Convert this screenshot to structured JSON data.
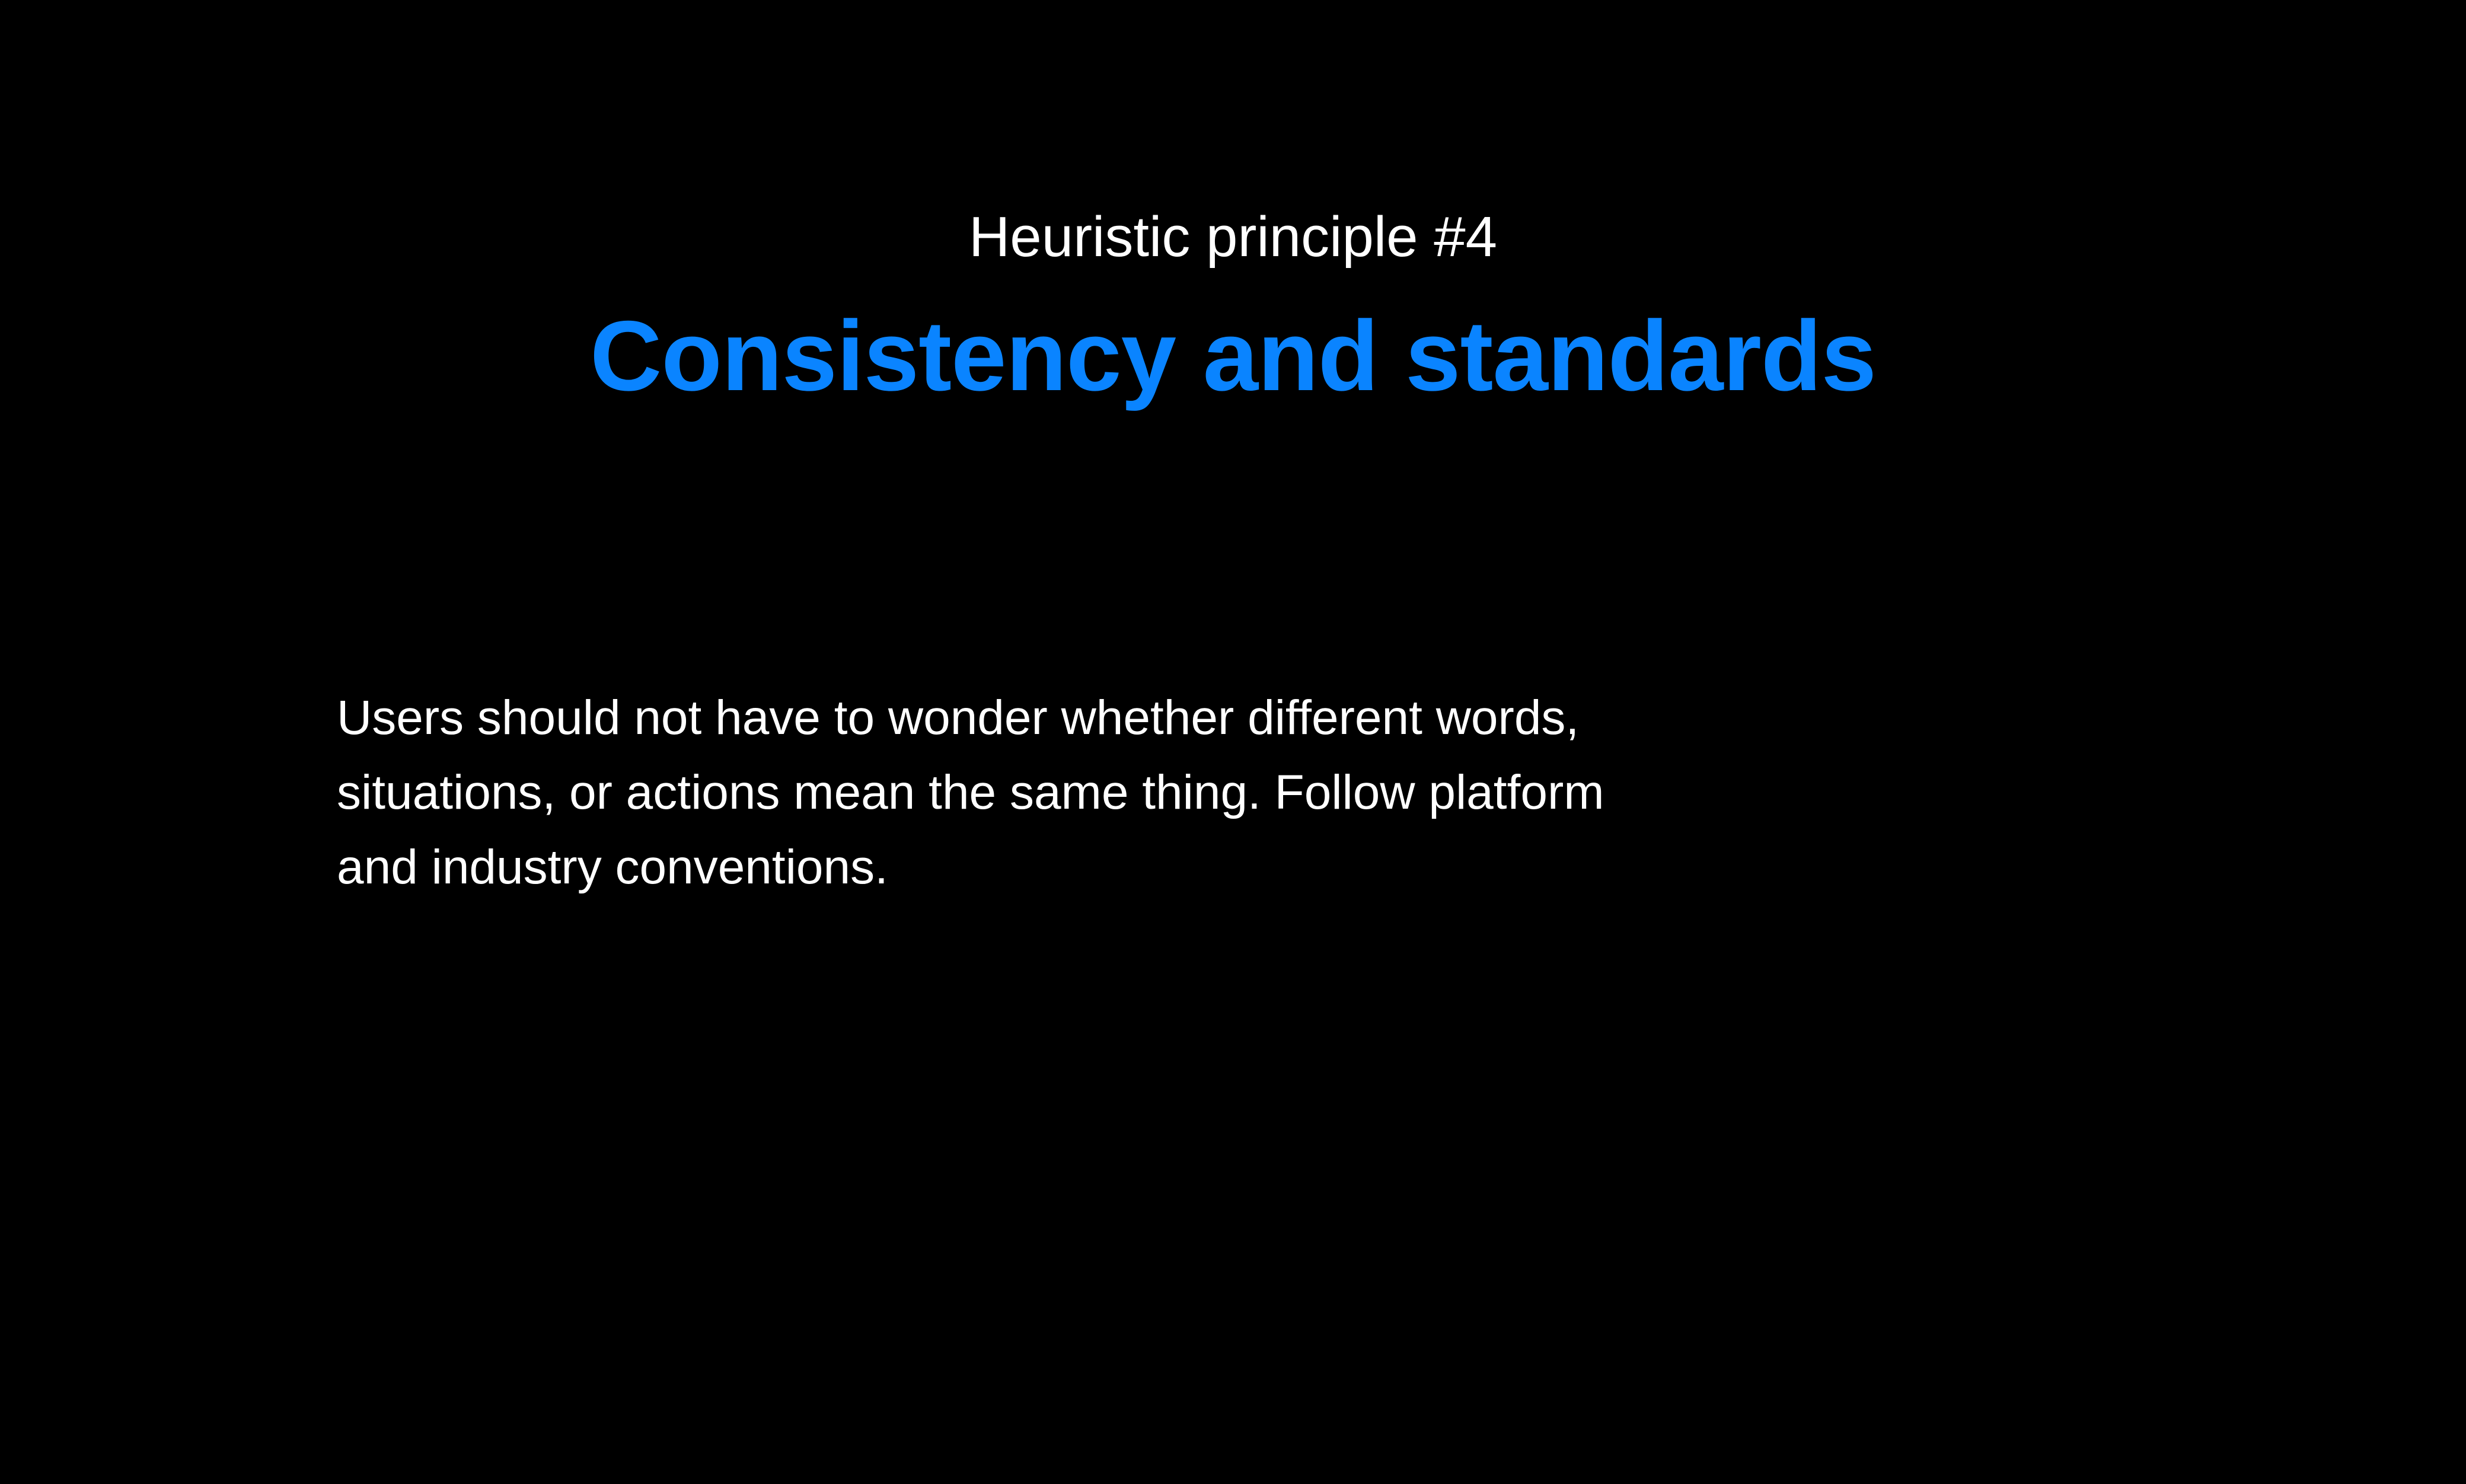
{
  "slide": {
    "eyebrow": "Heuristic principle #4",
    "title": "Consistency and standards",
    "body_lines": [
      "Users should not have to wonder whether different words,",
      "situations, or actions mean the same thing. Follow platform",
      "and industry conventions."
    ]
  },
  "colors": {
    "background": "#000000",
    "title": "#0a84ff",
    "text": "#ffffff"
  }
}
